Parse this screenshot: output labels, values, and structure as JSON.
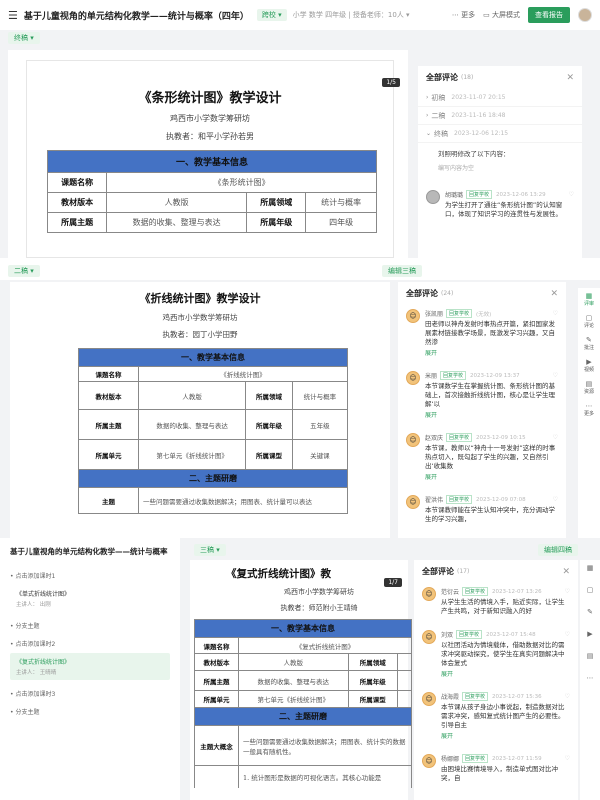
{
  "header": {
    "menu_icon": "hamburger-icon",
    "title": "基于儿童视角的单元结构化教学——统计与概率（四年）",
    "school_pill": "跨校 ▾",
    "meta": "小学  数学  四年级  | 授备老师：10人 ▾",
    "more": "更多",
    "big_screen": "大屏模式",
    "report_button": "查看报告"
  },
  "panel1": {
    "version": "终稿 ▾",
    "page": "1/5",
    "doc": {
      "title": "《条形统计图》教学设计",
      "org": "鸡西市小学数学筹研坊",
      "author": "执教者：和平小学孙若男",
      "section": "一、教学基本信息",
      "rows": [
        [
          "课题名称",
          "《条形统计图》",
          "",
          ""
        ],
        [
          "教材版本",
          "人教版",
          "所属领域",
          "统计与概率"
        ],
        [
          "所属主题",
          "数据的收集、整理与表达",
          "所属年级",
          "四年级"
        ]
      ]
    },
    "comments": {
      "title": "全部评论",
      "count": "(18)",
      "versions": [
        {
          "name": "初稿",
          "date": "2023-11-07 20:15"
        },
        {
          "name": "二稿",
          "date": "2023-11-16 18:48"
        },
        {
          "name": "终稿",
          "date": "2023-12-06 12:15"
        }
      ],
      "note": "刘照明修改了以下内容：",
      "note_sub": "编写内容为空",
      "items": [
        {
          "name": "胡璐璐",
          "tag": "回复学校",
          "date": "2023-12-06 13:29",
          "text": "为学生打开了通往“条形统计图”的认知窗口，体现了知识学习的连贯性与发展性。"
        }
      ]
    }
  },
  "panel2": {
    "version": "二稿 ▾",
    "edit": "编辑三稿",
    "page": "",
    "doc": {
      "title": "《折线统计图》教学设计",
      "org": "鸡西市小学数学筹研坊",
      "author": "执教者：园丁小学田野",
      "section": "一、教学基本信息",
      "section2": "二、主题研磨",
      "rows": [
        [
          "课题名称",
          "《折线统计图》",
          "",
          ""
        ],
        [
          "教材版本",
          "人教版",
          "所属领域",
          "统计与概率"
        ],
        [
          "所属主题",
          "数据的收集、整理与表达",
          "所属年级",
          "五年级"
        ],
        [
          "所属单元",
          "第七单元《折线统计图》",
          "所属课型",
          "关键课"
        ]
      ],
      "row_theme": [
        "主题",
        "一些问题需要通过收集数据解决；用图表、统计量可以表达"
      ]
    },
    "comments": {
      "title": "全部评论",
      "count": "(24)",
      "items": [
        {
          "name": "张凯丽",
          "tag": "回复学校",
          "date": "(无效)",
          "text": "田老师以神舟发射时事热点开篇，紧扣国家发展素材链接教学场景，既激发学习兴趣，又自然渗",
          "more": "展开"
        },
        {
          "name": "米丽",
          "tag": "回复学校",
          "date": "2023-12-09 13:37",
          "text": "本节课数学生在掌握统计图、条形统计图的基础上，首次接触折线统计图，核心是让学生理解‘以",
          "more": "展开"
        },
        {
          "name": "赵双庆",
          "tag": "回复学校",
          "date": "2023-12-09 10:15",
          "text": "本节课，教师以“神舟十一号发射”这样的时事热点切入，既勾起了学生的兴趣，又自然引出‘收集数",
          "more": "展开"
        },
        {
          "name": "翟洪伟",
          "tag": "回复学校",
          "date": "2023-12-09 07:08",
          "text": "本节课教师能在学生认知冲突中，充分调动学生的学习兴趣，",
          "more": ""
        }
      ]
    },
    "sidebar": [
      {
        "icon": "comment-icon",
        "label": "评论"
      },
      {
        "icon": "annotation-icon",
        "label": "批注"
      },
      {
        "icon": "video-icon",
        "label": "视频"
      },
      {
        "icon": "resource-icon",
        "label": "资源"
      },
      {
        "icon": "more-icon",
        "label": "更多"
      }
    ],
    "sidebar_first": {
      "icon": "grid-icon",
      "label": "评审"
    }
  },
  "panel3": {
    "outline": {
      "title": "基于儿童视角的单元结构化教学——统计与概率",
      "items": [
        {
          "type": "sec",
          "text": "点击添加课时1"
        },
        {
          "type": "card",
          "title": "《单式折线统计图》",
          "sub": "主讲人：   出刚"
        },
        {
          "type": "sec",
          "text": "分支主题"
        },
        {
          "type": "sec",
          "text": "点击添加课时2"
        },
        {
          "type": "card",
          "title": "《复式折线统计图》",
          "sub": "主讲人：   王晴晴",
          "selected": true
        },
        {
          "type": "sec",
          "text": "点击添加课时3"
        },
        {
          "type": "sec",
          "text": "分支主题"
        }
      ]
    },
    "version": "三稿 ▾",
    "edit": "编辑四稿",
    "page": "1/7",
    "doc": {
      "title": "《复式折线统计图》教",
      "org": "鸡西市小学数学筹研坊",
      "author": "执教者：师范附小王靖绮",
      "section": "一、教学基本信息",
      "section2": "二、主题研磨",
      "rows": [
        [
          "课题名称",
          "《复式折线统计图》",
          "",
          ""
        ],
        [
          "教材版本",
          "人教版",
          "所属领域",
          ""
        ],
        [
          "所属主题",
          "数据的收集、整理与表达",
          "所属年级",
          ""
        ],
        [
          "所属单元",
          "第七单元《折线统计图》",
          "所属课型",
          ""
        ]
      ],
      "row_theme": [
        "主题大概念",
        "一些问题需要通过收集数据解决；用图表、统计实的数据一般具有随机性。"
      ],
      "note": "1. 统计图形是数据的可视化语言。其核心功能是"
    },
    "comments": {
      "title": "全部评论",
      "count": "(17)",
      "items": [
        {
          "name": "范衍云",
          "tag": "回复学校",
          "date": "2023-12-07 13:26",
          "text": "从学生生活的情境入手，贴近实际，让学生产生共鸣，对于新知识融入的好",
          "more": ""
        },
        {
          "name": "刘双",
          "tag": "回复学校",
          "date": "2023-12-07 15:48",
          "text": "以社团活动为情境载体，借助数据对比的需求冲突驱动探究，使学生在真实问题解决中体会复式",
          "more": "展开"
        },
        {
          "name": "战海霞",
          "tag": "回复学校",
          "date": "2023-12-07 15:36",
          "text": "本节课从孩子身边小事说起，制造数据对比需求冲突，感知复式统计图产生的必要性。引导自主",
          "more": "展开"
        },
        {
          "name": "杨娜娜",
          "tag": "回复学校",
          "date": "2023-12-07 11:59",
          "text": "由困境比赛情境导入，制造单式图对比冲突，自",
          "more": ""
        }
      ]
    }
  },
  "colors": {
    "accent": "#2a9d5c",
    "table_header": "#4472c4"
  }
}
